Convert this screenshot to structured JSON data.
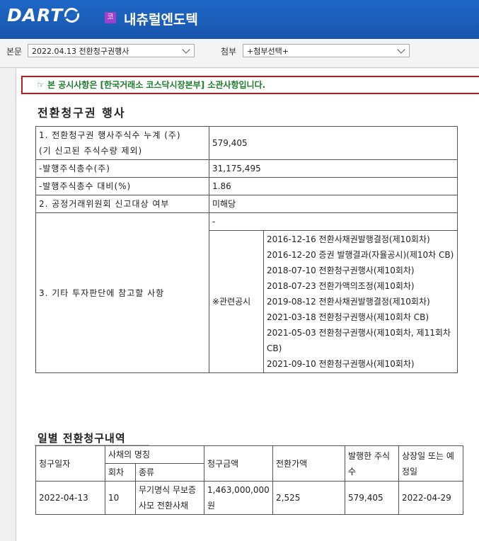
{
  "header": {
    "logo": "DART",
    "corp_badge": "코",
    "corp_name": "내츄럴엔도텍"
  },
  "selectors": {
    "main_label": "본문",
    "main_value": "2022.04.13  전환청구권행사",
    "attach_label": "첨부",
    "attach_value": "+첨부선택+"
  },
  "notice": {
    "icon": "☞",
    "text": "본 공시사항은 [한국거래소 코스닥시장본부] 소관사항입니다."
  },
  "section1": {
    "title": "전환청구권 행사",
    "rows": [
      {
        "label": "1. 전환청구권 행사주식수 누계 (주)\n(기 신고된 주식수량 제외)",
        "value": "579,405"
      },
      {
        "label": "-발행주식총수(주)",
        "value": "31,175,495"
      },
      {
        "label": "-발행주식총수 대비(%)",
        "value": "1.86"
      },
      {
        "label": "2. 공정거래위원회 신고대상 여부",
        "value": "미해당"
      }
    ],
    "other_label": "3. 기타 투자판단에 참고할 사항",
    "other_value": "-",
    "related_label": "※관련공시",
    "related": [
      "2016-12-16 전환사채권발행결정(제10회차)",
      "2016-12-20 증권 발행결과(자율공시)(제10차 CB)",
      "2018-07-10 전환청구권행사(제10회차)",
      "2018-07-23 전환가액의조정(제10회차)",
      "2019-08-12 전환사채권발행결정(제10회차)",
      "2021-03-18 전환청구권행사(제10회차 CB)",
      "2021-05-03 전환청구권행사(제10회차, 제11회차 CB)",
      "2021-09-10 전환청구권행사(제10회차)"
    ]
  },
  "section2": {
    "title": "일별 전환청구내역",
    "headers": {
      "date": "청구일자",
      "bond_name": "사채의 명칭",
      "round": "회차",
      "kind": "종류",
      "amount": "청구금액",
      "price": "전환가액",
      "shares": "발행한 주식수",
      "listing": "상장일 또는 예정일"
    },
    "rows": [
      {
        "date": "2022-04-13",
        "round": "10",
        "kind": "무기명식 무보증 사모 전환사채",
        "amount": "1,463,000,000원",
        "price": "2,525",
        "shares": "579,405",
        "listing": "2022-04-29"
      }
    ]
  }
}
